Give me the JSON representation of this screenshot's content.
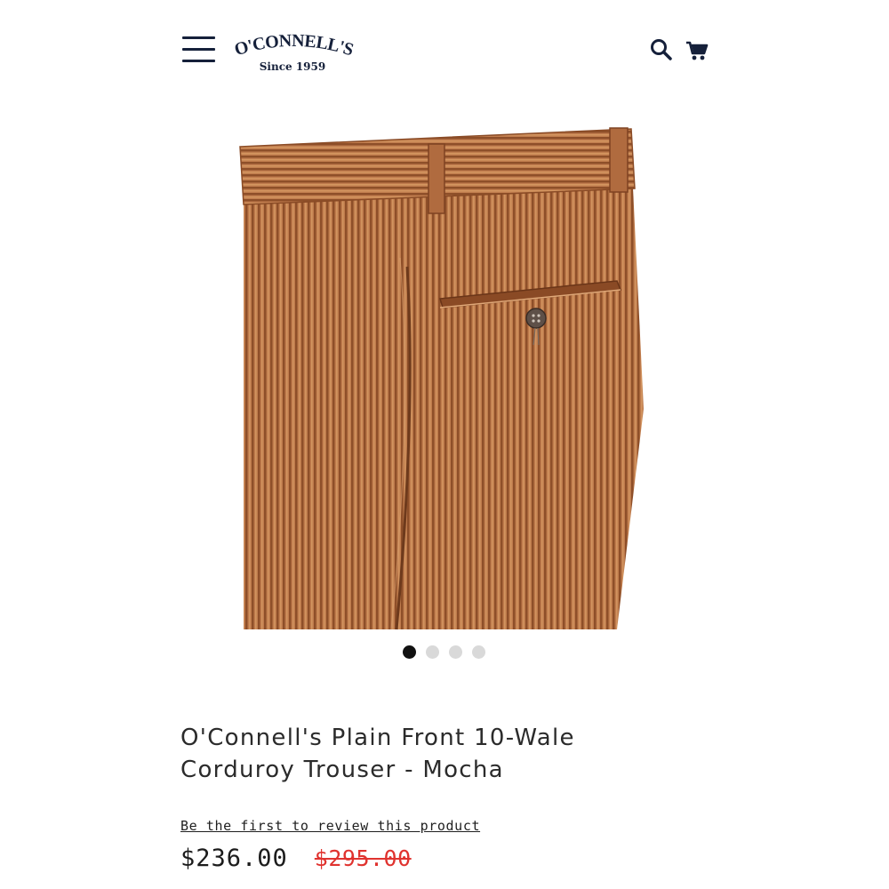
{
  "header": {
    "logo_text": "O'CONNELL'S",
    "logo_subtitle": "Since 1959",
    "menu_icon": "hamburger-menu-icon",
    "search_icon": "search-icon",
    "cart_icon": "cart-icon"
  },
  "gallery": {
    "image_alt": "Plain Front 10-Wale Corduroy Trouser in Mocha",
    "slide_count": 4,
    "active_index": 0
  },
  "product": {
    "title": "O'Connell's Plain Front 10-Wale Corduroy Trouser - Mocha",
    "review_link": "Be the first to review this product",
    "price": "$236.00",
    "original_price": "$295.00"
  },
  "colors": {
    "brand_navy": "#15203a",
    "sale_red": "#e0332f",
    "corduroy": "#b87446",
    "dot_active": "#111111",
    "dot_inactive": "#d9d9d9"
  }
}
